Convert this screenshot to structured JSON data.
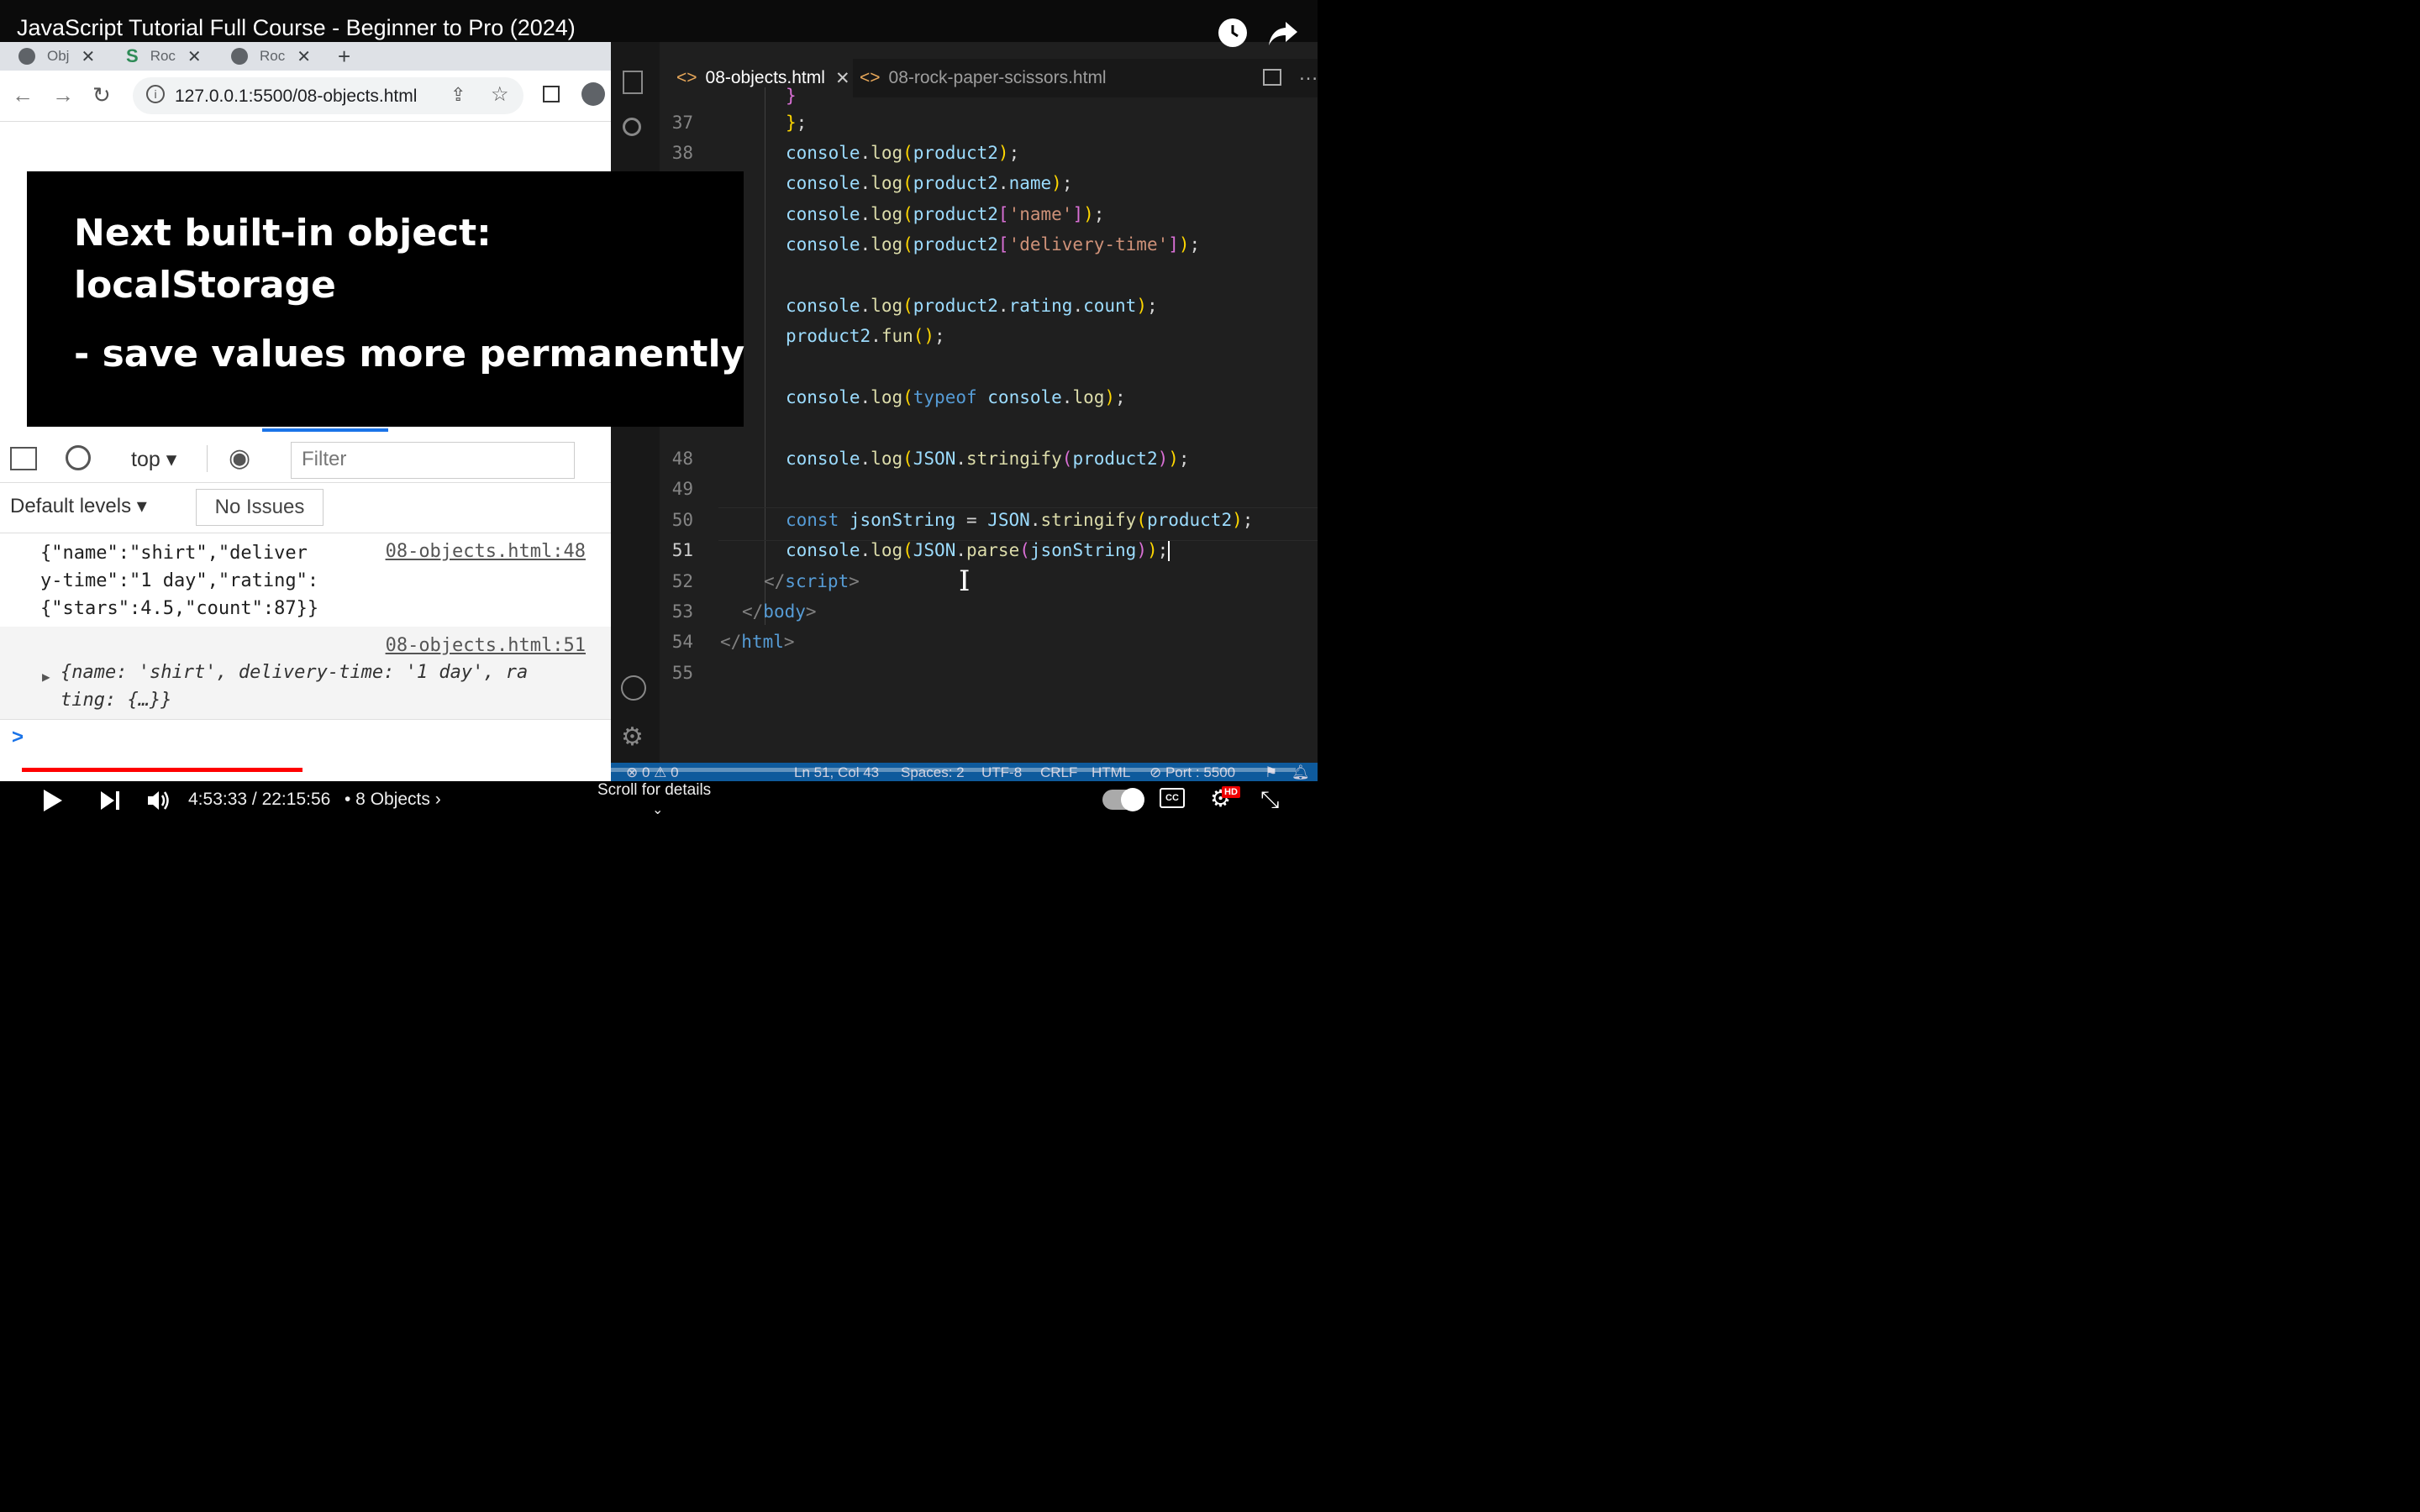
{
  "video": {
    "title": "JavaScript Tutorial Full Course - Beginner to Pro (2024)",
    "time_current": "4:53:33",
    "time_total": "22:15:56",
    "time_display": "4:53:33 / 22:15:56",
    "chapter": "• 8 Objects ›",
    "scroll_hint": "Scroll for details",
    "progress_fraction": 0.22,
    "hd_badge": "HD"
  },
  "browser": {
    "tabs": [
      {
        "label": "Obj",
        "icon": "globe-icon"
      },
      {
        "label": "Roc",
        "icon": "s-logo-icon"
      },
      {
        "label": "Roc",
        "icon": "globe-icon"
      }
    ],
    "url": "127.0.0.1:5500/08-objects.html"
  },
  "devtools": {
    "context": "top",
    "filter_placeholder": "Filter",
    "levels": "Default levels",
    "issues": "No Issues",
    "entries": [
      {
        "lines": [
          "{\"name\":\"shirt\",\"deliver",
          "y-time\":\"1 day\",\"rating\":",
          "{\"stars\":4.5,\"count\":87}}"
        ],
        "source": "08-objects.html:48"
      },
      {
        "source": "08-objects.html:51",
        "obj_lines": [
          "{name: 'shirt', delivery-time: '1 day', ra",
          "ting: {…}}"
        ]
      }
    ],
    "prompt": ">"
  },
  "overlay": {
    "line1": "Next built-in object:",
    "line2": "localStorage",
    "line3": "- save values more permanently"
  },
  "editor": {
    "tabs": [
      {
        "label": "08-objects.html",
        "active": true
      },
      {
        "label": "08-rock-paper-scissors.html",
        "active": false
      }
    ],
    "line_numbers": [
      "37",
      "38",
      "48",
      "49",
      "50",
      "51",
      "52",
      "53",
      "54",
      "55"
    ],
    "status": {
      "errors": "⊗ 0 ⚠ 0",
      "position": "Ln 51, Col 43",
      "spaces": "Spaces: 2",
      "encoding": "UTF-8",
      "eol": "CRLF",
      "language": "HTML",
      "port": "⊘ Port : 5500"
    }
  },
  "colors": {
    "progress": "#ff0000",
    "editor_bg": "#1f1f1f",
    "statusbar": "#0e5a9c",
    "keyword": "#569cd6",
    "variable": "#9cdcfe",
    "function": "#dcdcaa",
    "string": "#ce9178"
  }
}
